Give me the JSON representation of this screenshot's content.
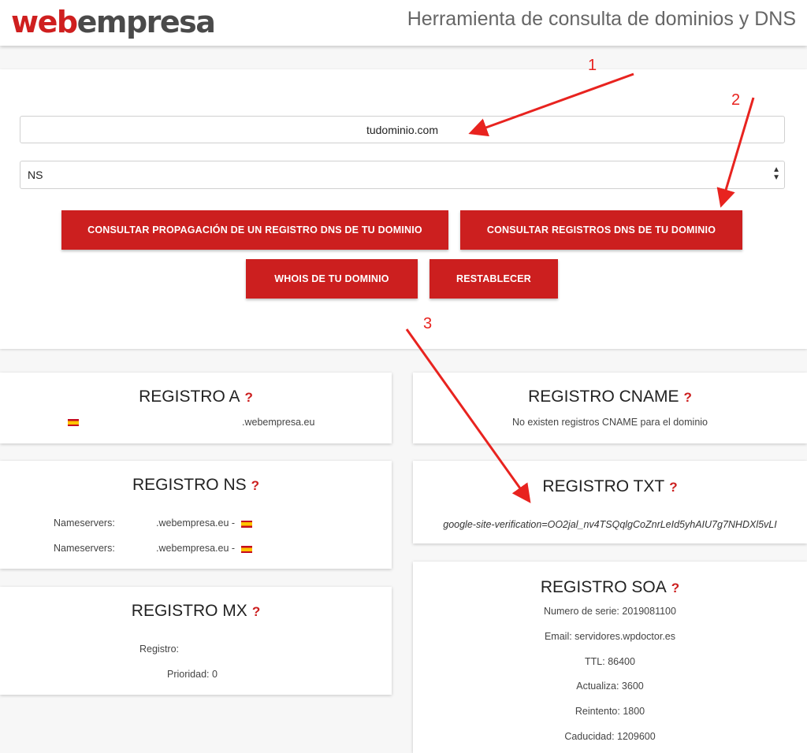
{
  "header": {
    "logo_part1": "web",
    "logo_part2": "empresa",
    "title": "Herramienta de consulta de dominios y DNS"
  },
  "form": {
    "domain_value": "tudominio.com",
    "record_type": "NS",
    "buttons": {
      "propagation": "CONSULTAR PROPAGACIÓN DE UN REGISTRO DNS DE TU DOMINIO",
      "dns_records": "CONSULTAR REGISTROS DNS DE TU DOMINIO",
      "whois": "WHOIS DE TU DOMINIO",
      "reset": "RESTABLECER"
    }
  },
  "annotations": [
    "1",
    "2",
    "3"
  ],
  "cards": {
    "a": {
      "title": "REGISTRO A",
      "help": "?",
      "host": ".webempresa.eu"
    },
    "cname": {
      "title": "REGISTRO CNAME",
      "help": "?",
      "message": "No existen registros CNAME para el dominio"
    },
    "ns": {
      "title": "REGISTRO NS",
      "help": "?",
      "rows": [
        {
          "label": "Nameservers:",
          "value": ".webempresa.eu -"
        },
        {
          "label": "Nameservers:",
          "value": ".webempresa.eu -"
        }
      ]
    },
    "txt": {
      "title": "REGISTRO TXT",
      "help": "?",
      "value": "google-site-verification=OO2jal_nv4TSQqlgCoZnrLeId5yhAIU7g7NHDXl5vLI"
    },
    "mx": {
      "title": "REGISTRO MX",
      "help": "?",
      "registro_label": "Registro:",
      "prioridad": "Prioridad: 0"
    },
    "soa": {
      "title": "REGISTRO SOA",
      "help": "?",
      "rows": [
        "Numero de serie: 2019081100",
        "Email: servidores.wpdoctor.es",
        "TTL: 86400",
        "Actualiza: 3600",
        "Reintento: 1800",
        "Caducidad: 1209600"
      ]
    }
  },
  "colors": {
    "brand_red": "#cc1f1f",
    "annotation_red": "#e8231f"
  }
}
